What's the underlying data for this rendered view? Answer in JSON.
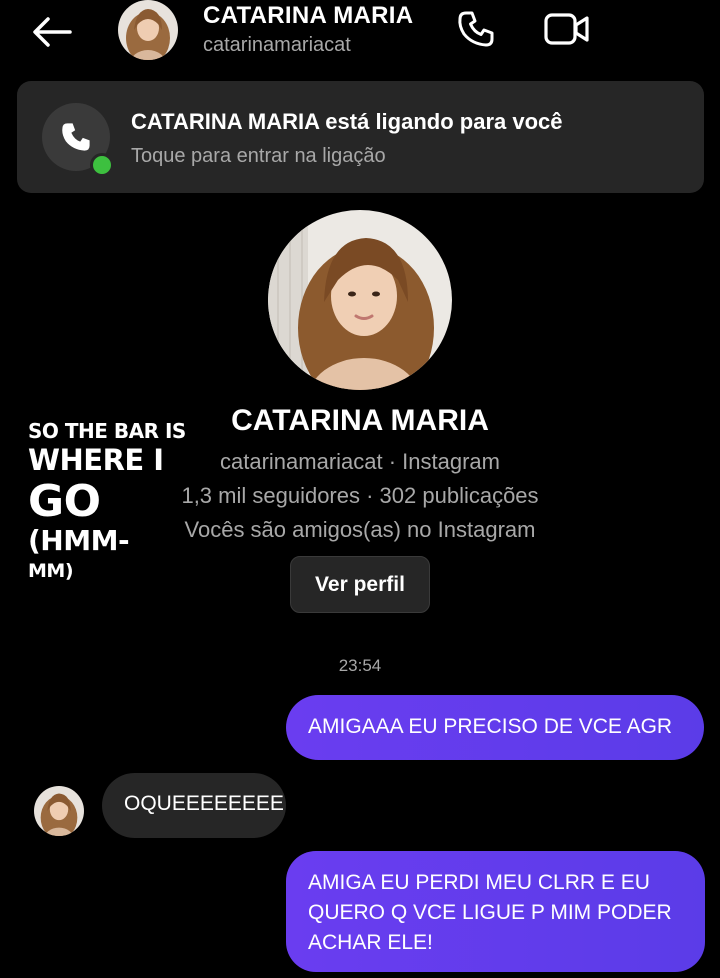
{
  "header": {
    "name": "CATARINA MARIA",
    "username": "catarinamariacat"
  },
  "call_banner": {
    "title": "CATARINA MARIA está ligando para você",
    "subtitle": "Toque para entrar na ligação"
  },
  "profile": {
    "name": "CATARINA MARIA",
    "source": "catarinamariacat · Instagram",
    "stats": "1,3 mil seguidores · 302 publicações",
    "relation": "Vocês são amigos(as) no Instagram",
    "view_profile_label": "Ver perfil"
  },
  "overlay_lyric": {
    "line1": "SO THE BAR IS",
    "line2": "WHERE I",
    "line3": "GO",
    "line4": "(HMM-",
    "line5": "MM)"
  },
  "chat": {
    "timestamp": "23:54",
    "messages": [
      {
        "from": "me",
        "text": "AMIGAAA EU PRECISO DE VCE AGR"
      },
      {
        "from": "them",
        "text": "OQUEEEEEEEE"
      },
      {
        "from": "me",
        "text": "AMIGA EU PERDI MEU CLRR E EU QUERO Q VCE LIGUE P MIM PODER ACHAR ELE!"
      }
    ]
  },
  "colors": {
    "background": "#000000",
    "surface": "#262626",
    "secondary_text": "#a8a8a8",
    "outgoing_bubble": "#5b3ce8",
    "online_dot": "#3dc03f"
  },
  "icons": [
    "back-arrow-icon",
    "phone-icon",
    "video-camera-icon"
  ]
}
